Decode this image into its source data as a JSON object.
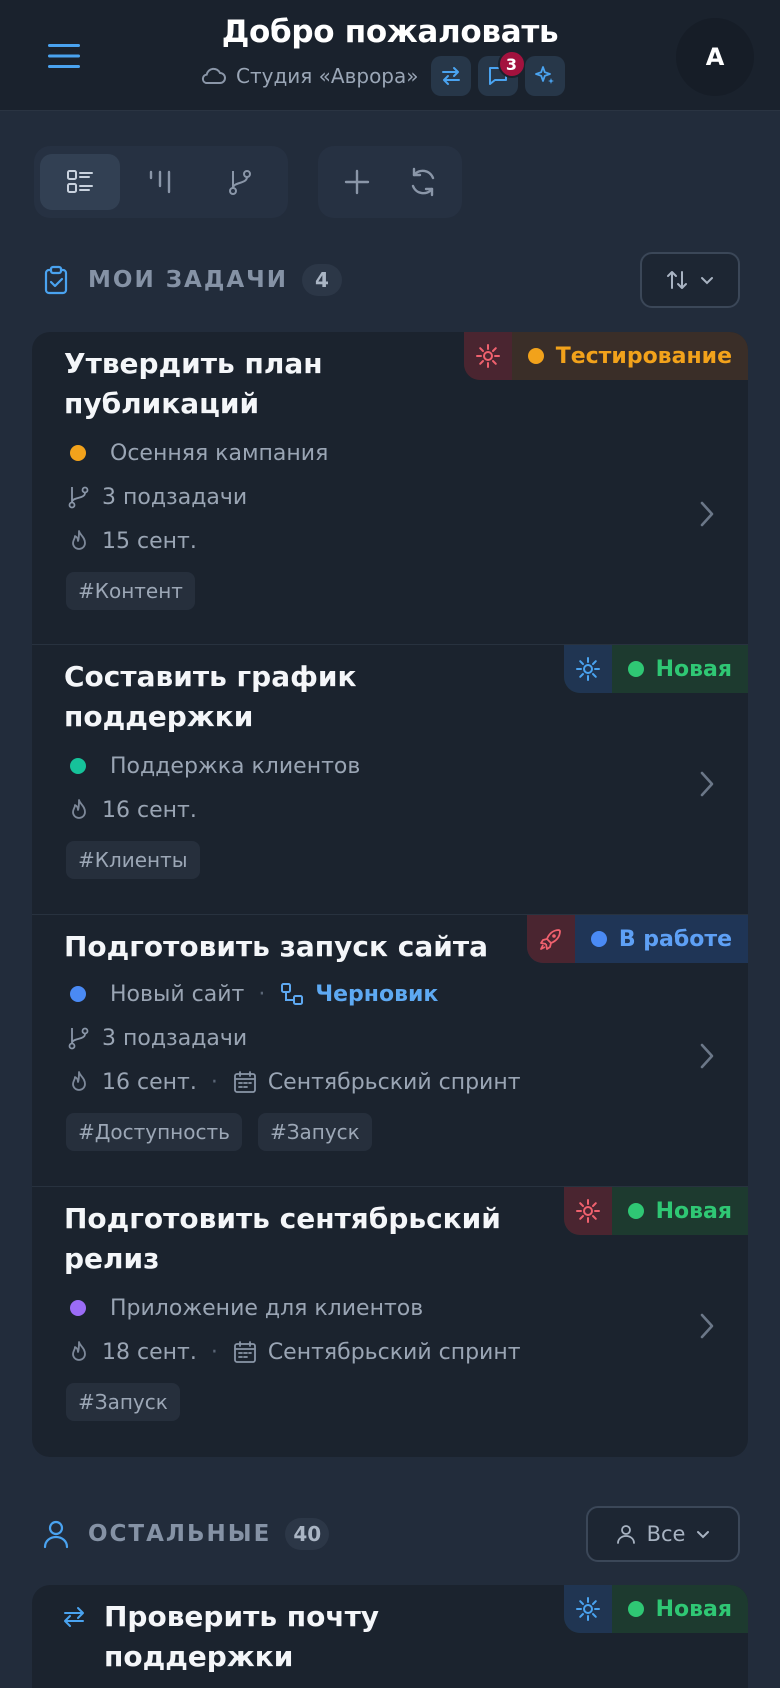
{
  "header": {
    "title": "Добро пожаловать",
    "studio": "Студия «Аврора»",
    "notifications_count": "3",
    "avatar_initial": "A"
  },
  "colors": {
    "accent": "#4aa3f0",
    "orange": "#f2a21b",
    "green": "#2fc774",
    "blue": "#4a8af4",
    "purple": "#9b6cf6",
    "teal": "#16c29a"
  },
  "toolbar": {
    "view_icons": [
      "list-view-icon",
      "board-view-icon",
      "branch-view-icon"
    ],
    "action_icons": [
      "add-icon",
      "refresh-icon"
    ]
  },
  "my_tasks": {
    "title": "МОИ ЗАДАЧИ",
    "count": "4",
    "sort_icon": "sort-icon"
  },
  "tasks": [
    {
      "title_lines": [
        "Утвердить план",
        "публикаций"
      ],
      "project": "Осенняя кампания",
      "subtasks": "3 подзадачи",
      "due": "15 сент.",
      "tags": [
        "#Контент"
      ],
      "status": "Тестирование",
      "status_icon": "gear-icon"
    },
    {
      "title_lines": [
        "Составить график",
        "поддержки"
      ],
      "project": "Поддержка клиентов",
      "due": "16 сент.",
      "tags": [
        "#Клиенты"
      ],
      "status": "Новая",
      "status_icon": "gear-icon"
    },
    {
      "title_lines": [
        "Подготовить запуск сайта"
      ],
      "project": "Новый сайт",
      "draft": "Черновик",
      "subtasks": "3 подзадачи",
      "due": "16 сент.",
      "sprint": "Сентябрьский спринт",
      "tags": [
        "#Доступность",
        "#Запуск"
      ],
      "status": "В работе",
      "status_icon": "rocket-icon"
    },
    {
      "title_lines": [
        "Подготовить сентябрьский",
        "релиз"
      ],
      "project": "Приложение для клиентов",
      "due": "18 сент.",
      "sprint": "Сентябрьский спринт",
      "tags": [
        "#Запуск"
      ],
      "status": "Новая",
      "status_icon": "gear-icon"
    }
  ],
  "others": {
    "title": "ОСТАЛЬНЫЕ",
    "count": "40",
    "filter_label": "Все"
  },
  "other_tasks": [
    {
      "title_lines": [
        "Проверить почту",
        "поддержки"
      ],
      "status": "Новая",
      "status_icon": "gear-icon"
    }
  ]
}
